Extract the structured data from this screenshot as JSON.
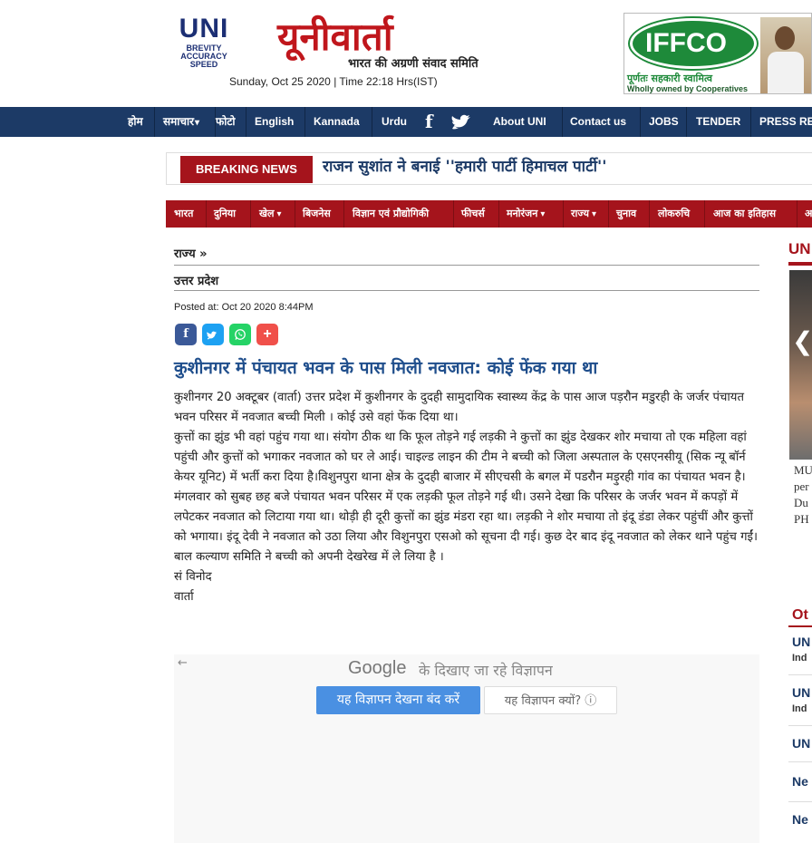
{
  "header": {
    "uni_logo_text": "UNI",
    "uni_tagline": [
      "BREVITY",
      "ACCURACY",
      "SPEED"
    ],
    "brand_title": "यूनीवार्ता",
    "brand_subtitle": "भारत की अग्रणी संवाद समिति",
    "datetime": "Sunday, Oct 25 2020 | Time 22:18 Hrs(IST)"
  },
  "ad_banner": {
    "logo_text": "IFFCO",
    "line1": "पूर्णतः सहकारी स्वामित्व",
    "line2": "Wholly owned by Cooperatives"
  },
  "top_nav": {
    "items": [
      "होम",
      "समाचार",
      "फोटो",
      "English",
      "Kannada",
      "Urdu",
      "About UNI",
      "Contact us",
      "JOBS",
      "TENDER",
      "PRESS RE"
    ]
  },
  "breaking": {
    "label": "BREAKING NEWS",
    "headline": "राजन सुशांत ने बनाई ''हमारी पार्टी हिमाचल पार्टी''"
  },
  "category_nav": {
    "items": [
      "भारत",
      "दुनिया",
      "खेल",
      "बिजनेस",
      "विज्ञान एवं प्रौद्योगिकी",
      "फीचर्स",
      "मनोरंजन",
      "राज्य",
      "चुनाव",
      "लोकरुचि",
      "आज का इतिहास",
      "अ"
    ]
  },
  "article": {
    "breadcrumb1": "राज्य »",
    "breadcrumb2": "उत्तर प्रदेश",
    "posted": "Posted at: Oct 20 2020 8:44PM",
    "share_buttons": [
      "f",
      "t",
      "w",
      "+"
    ],
    "headline": "कुशीनगर में पंचायत भवन के पास मिली नवजात: कोई फेंक गया था",
    "paragraphs": [
      "कुशीनगर 20 अक्टूबर (वार्ता) उत्तर प्रदेश में कुशीनगर के दुदही सामुदायिक स्वास्थ्य केंद्र के पास आज पड़रौन मडुरही के जर्जर पंचायत भवन परिसर में नवजात बच्ची मिली । कोई उसे वहां फेंक दिया था।",
      "कुत्तों का झुंड भी वहां पहुंच गया था। संयोग ठीक था कि फूल तोड़ने गई लड़की ने कुत्तों का झुंड देखकर शोर मचाया तो एक महिला वहां पहुंची और कुत्तों को भगाकर नवजात को घर ले आई। चाइल्ड लाइन की टीम ने बच्ची को जिला अस्पताल के एसएनसीयू (सिक न्यू बॉर्न केयर यूनिट) में भर्ती करा दिया है।विशुनपुरा थाना क्षेत्र के दुदही बाजार में सीएचसी के बगल में पडरौन मड़ुरही गांव का पंचायत भवन है। मंगलवार को सुबह छह बजे पंचायत भवन परिसर में एक लड़की फूल तोड़ने गई थी। उसने देखा कि परिसर के जर्जर भवन में कपड़ों में लपेटकर नवजात को लिटाया गया था। थोड़ी ही दूरी कुत्तों का झुंड मंडरा रहा था। लड़की ने शोर मचाया तो इंदू डंडा लेकर पहुंचीं और कुत्तों को भगाया। इंदू देवी ने नवजात को उठा लिया और विशुनपुरा एसओ को सूचना दी गई। कुछ देर बाद इंदू नवजात को लेकर थाने पहुंच गईं।",
      "बाल कल्याण समिति ने बच्ची को अपनी देखरेख में ले लिया है ।",
      "सं विनोद",
      "वार्ता"
    ]
  },
  "google_ad": {
    "back": "←",
    "google": "Google",
    "text": "के दिखाए जा रहे विज्ञापन",
    "stop_button": "यह विज्ञापन देखना बंद करें",
    "why_button": "यह विज्ञापन क्यों? ⓘ"
  },
  "sidebar": {
    "heading": "UN",
    "caption": [
      "MU",
      "per",
      "Du",
      "PH"
    ],
    "other_heading": "Ot",
    "items": [
      {
        "title": "UN",
        "sub": "Ind"
      },
      {
        "title": "UN",
        "sub": "Ind"
      },
      {
        "title": "UN",
        "sub": ""
      },
      {
        "title": "Ne",
        "sub": ""
      },
      {
        "title": "Ne",
        "sub": ""
      }
    ]
  },
  "colors": {
    "nav_blue": "#1c3a66",
    "brand_red": "#a5141c",
    "headline_blue": "#1f4e8c",
    "facebook": "#3b5998",
    "twitter": "#1da1f2",
    "whatsapp": "#25d366",
    "more": "#f0504a"
  }
}
